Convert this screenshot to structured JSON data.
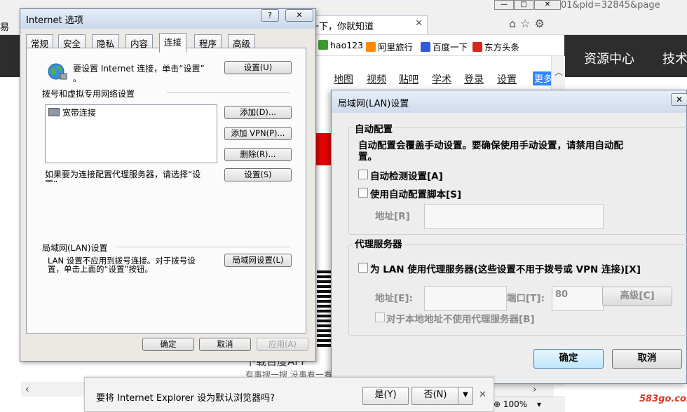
{
  "background_browser": {
    "tab_title": "度一下，你就知道",
    "url_fragment": "01&pid=32845&page",
    "favorites": [
      "hao123",
      "阿里旅行",
      "百度一下",
      "东方头条"
    ],
    "header_links": [
      "资源中心",
      "技术"
    ],
    "nav_links": [
      "地图",
      "视频",
      "贴吧",
      "学术",
      "登录",
      "设置"
    ],
    "nav_more": "更多",
    "bottom_text": "下载百度APP",
    "bottom_text2": "有事搜一搜 没事看一看",
    "zoom": "100%",
    "left_fragment": "易"
  },
  "internet_options": {
    "title": "Internet 选项",
    "help_label": "?",
    "close_label": "✕",
    "tabs": [
      "常规",
      "安全",
      "隐私",
      "内容",
      "连接",
      "程序",
      "高级"
    ],
    "active_tab": "连接",
    "setup_text_line1": "要设置 Internet 连接，单击“设置”",
    "setup_text_line2": "。",
    "setup_button": "设置(U)",
    "dialup_section": "拨号和虚拟专用网络设置",
    "connections": [
      "宽带连接"
    ],
    "add_button": "添加(D)...",
    "add_vpn_button": "添加 VPN(P)...",
    "remove_button": "删除(R)...",
    "proxy_text_line1": "如果要为连接配置代理服务器，请选择“设",
    "proxy_text_line2": "置”。",
    "settings_button": "设置(S)",
    "lan_section": "局域网(LAN)设置",
    "lan_text_line1": "LAN 设置不应用到拨号连接。对于拨号设",
    "lan_text_line2": "置，单击上面的“设置”按钮。",
    "lan_button": "局域网设置(L)",
    "ok_button": "确定",
    "cancel_button": "取消",
    "apply_button": "应用(A)"
  },
  "lan_settings": {
    "title": "局域网(LAN)设置",
    "close_label": "✕",
    "auto_config_title": "自动配置",
    "auto_config_desc_line1": "自动配置会覆盖手动设置。要确保使用手动设置，请禁用自动配",
    "auto_config_desc_line2": "置。",
    "auto_detect_label": "自动检测设置[A]",
    "auto_detect_checked": false,
    "auto_script_label": "使用自动配置脚本[S]",
    "auto_script_checked": false,
    "script_address_label": "地址[R]",
    "script_address_value": "",
    "proxy_title": "代理服务器",
    "use_proxy_label": "为 LAN 使用代理服务器(这些设置不用于拨号或 VPN 连接)[X]",
    "use_proxy_checked": false,
    "proxy_address_label": "地址[E]:",
    "proxy_address_value": "",
    "port_label": "端口[T]:",
    "port_value": "80",
    "advanced_button": "高级[C]",
    "bypass_label": "对于本地地址不使用代理服务器[B]",
    "bypass_checked": false,
    "ok_button": "确定",
    "cancel_button": "取消"
  },
  "notification": {
    "message": "要将 Internet Explorer 设为默认浏览器吗?",
    "yes_button": "是(Y)",
    "no_button": "否(N)",
    "dropdown_arrow": "▼",
    "close_label": "✕"
  },
  "watermark": "583go.com"
}
